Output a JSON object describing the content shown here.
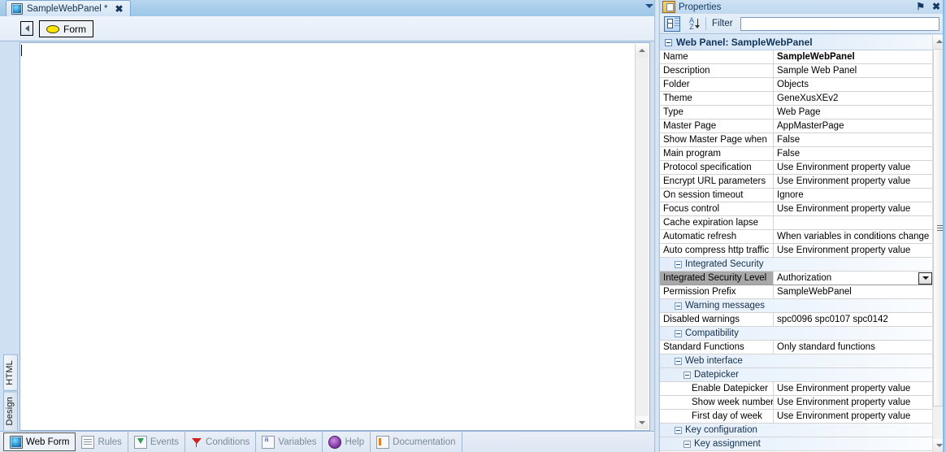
{
  "editor": {
    "tab": {
      "label": "SampleWebPanel *",
      "close": "✖",
      "icon": "webpanel-icon"
    },
    "toolbar": {
      "back_icon": "nav-back-icon",
      "form_button": "Form"
    },
    "side_tabs": [
      {
        "label": "HTML",
        "selected": true
      },
      {
        "label": "Design",
        "selected": false
      }
    ],
    "bottom_tabs": [
      {
        "label": "Web Form",
        "icon": "web-form-icon",
        "active": true
      },
      {
        "label": "Rules",
        "icon": "rules-icon",
        "active": false
      },
      {
        "label": "Events",
        "icon": "events-icon",
        "active": false
      },
      {
        "label": "Conditions",
        "icon": "conditions-filter-icon",
        "active": false
      },
      {
        "label": "Variables",
        "icon": "variables-icon",
        "active": false
      },
      {
        "label": "Help",
        "icon": "help-icon",
        "active": false
      },
      {
        "label": "Documentation",
        "icon": "documentation-icon",
        "active": false
      }
    ]
  },
  "properties": {
    "title": "Properties",
    "pin_icon": "⚑",
    "close_icon": "✖",
    "toolbar": {
      "categorized_icon": "categorized-view-icon",
      "sort_icon": "alphabetical-sort-icon",
      "filter_label": "Filter",
      "filter_value": "",
      "filter_placeholder": ""
    },
    "root": {
      "label": "Web Panel: SampleWebPanel"
    },
    "rows": [
      {
        "kind": "prop",
        "indent": 1,
        "name": "Name",
        "value": "SampleWebPanel",
        "bold": true
      },
      {
        "kind": "prop",
        "indent": 1,
        "name": "Description",
        "value": "Sample Web Panel"
      },
      {
        "kind": "prop",
        "indent": 1,
        "name": "Folder",
        "value": "Objects"
      },
      {
        "kind": "prop",
        "indent": 1,
        "name": "Theme",
        "value": "GeneXusXEv2"
      },
      {
        "kind": "prop",
        "indent": 1,
        "name": "Type",
        "value": "Web Page"
      },
      {
        "kind": "prop",
        "indent": 1,
        "name": "Master Page",
        "value": "AppMasterPage"
      },
      {
        "kind": "prop",
        "indent": 1,
        "name": "Show Master Page when",
        "value": "False"
      },
      {
        "kind": "prop",
        "indent": 1,
        "name": "Main program",
        "value": "False"
      },
      {
        "kind": "prop",
        "indent": 1,
        "name": "Protocol specification",
        "value": "Use Environment property value"
      },
      {
        "kind": "prop",
        "indent": 1,
        "name": "Encrypt URL parameters",
        "value": "Use Environment property value"
      },
      {
        "kind": "prop",
        "indent": 1,
        "name": "On session timeout",
        "value": "Ignore"
      },
      {
        "kind": "prop",
        "indent": 1,
        "name": "Focus control",
        "value": "Use Environment property value"
      },
      {
        "kind": "prop",
        "indent": 1,
        "name": "Cache expiration lapse",
        "value": ""
      },
      {
        "kind": "prop",
        "indent": 1,
        "name": "Automatic refresh",
        "value": "When variables in conditions change"
      },
      {
        "kind": "prop",
        "indent": 1,
        "name": "Auto compress http traffic",
        "value": "Use Environment property value"
      },
      {
        "kind": "group",
        "indent": 1,
        "name": "Integrated Security"
      },
      {
        "kind": "prop",
        "indent": 2,
        "name": "Integrated Security Level",
        "value": "Authorization",
        "selected": true,
        "dropdown": true
      },
      {
        "kind": "prop",
        "indent": 2,
        "name": "Permission Prefix",
        "value": "SampleWebPanel"
      },
      {
        "kind": "group",
        "indent": 1,
        "name": "Warning messages"
      },
      {
        "kind": "prop",
        "indent": 2,
        "name": "Disabled warnings",
        "value": "spc0096 spc0107 spc0142"
      },
      {
        "kind": "group",
        "indent": 1,
        "name": "Compatibility"
      },
      {
        "kind": "prop",
        "indent": 2,
        "name": "Standard Functions",
        "value": "Only standard functions"
      },
      {
        "kind": "group",
        "indent": 1,
        "name": "Web interface"
      },
      {
        "kind": "group",
        "indent": 2,
        "name": "Datepicker"
      },
      {
        "kind": "prop",
        "indent": 3,
        "name": "Enable Datepicker",
        "value": "Use Environment property value"
      },
      {
        "kind": "prop",
        "indent": 3,
        "name": "Show week numbers",
        "value": "Use Environment property value"
      },
      {
        "kind": "prop",
        "indent": 3,
        "name": "First day of week",
        "value": "Use Environment property value"
      },
      {
        "kind": "group",
        "indent": 1,
        "name": "Key configuration"
      },
      {
        "kind": "group",
        "indent": 2,
        "name": "Key assignment"
      }
    ]
  },
  "colors": {
    "chrome_blue": "#cfe0f2",
    "titlebar_blue": "#bfd8ee",
    "selection_gray": "#a8a8a8",
    "group_blue": "#e4eefa",
    "accent_text": "#12345c"
  }
}
